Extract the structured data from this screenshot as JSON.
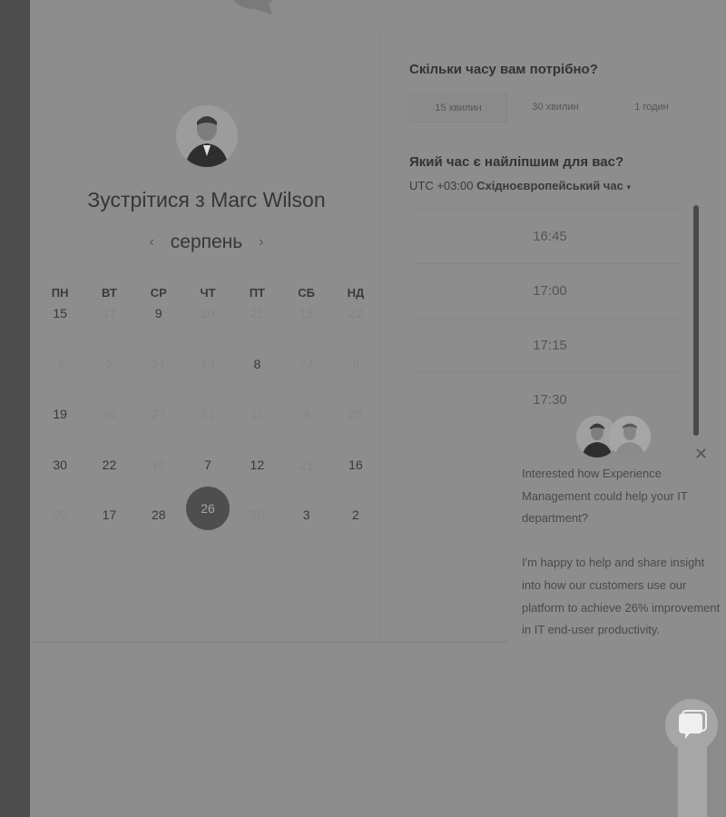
{
  "calendar_panel": {
    "title": "Зустрітися з Marc Wilson",
    "month": "серпень",
    "weekdays": [
      "ПН",
      "ВТ",
      "СР",
      "ЧТ",
      "ПТ",
      "СБ",
      "НД"
    ],
    "rows": [
      [
        {
          "d": "15",
          "dim": false
        },
        {
          "d": "17",
          "dim": true
        },
        {
          "d": "9",
          "dim": false
        },
        {
          "d": "20",
          "dim": true
        },
        {
          "d": "21",
          "dim": true
        },
        {
          "d": "13",
          "dim": true
        },
        {
          "d": "22",
          "dim": true
        }
      ],
      [
        {
          "d": "3",
          "dim": true
        },
        {
          "d": "2",
          "dim": true
        },
        {
          "d": "21",
          "dim": true
        },
        {
          "d": "19",
          "dim": true
        },
        {
          "d": "8",
          "dim": false
        },
        {
          "d": "24",
          "dim": true
        },
        {
          "d": "8",
          "dim": true
        }
      ],
      [
        {
          "d": "19",
          "dim": false
        },
        {
          "d": "24",
          "dim": true
        },
        {
          "d": "27",
          "dim": true
        },
        {
          "d": "21",
          "dim": true
        },
        {
          "d": "11",
          "dim": true
        },
        {
          "d": "9",
          "dim": true
        },
        {
          "d": "25",
          "dim": true
        }
      ],
      [
        {
          "d": "30",
          "dim": false
        },
        {
          "d": "22",
          "dim": false
        },
        {
          "d": "10",
          "dim": true
        },
        {
          "d": "7",
          "dim": false
        },
        {
          "d": "12",
          "dim": false
        },
        {
          "d": "21",
          "dim": true
        },
        {
          "d": "16",
          "dim": false
        }
      ],
      [
        {
          "d": "30",
          "dim": true
        },
        {
          "d": "17",
          "dim": false
        },
        {
          "d": "28",
          "dim": false
        },
        {
          "d": "26",
          "dim": false,
          "selected": true
        },
        {
          "d": "30",
          "dim": true
        },
        {
          "d": "3",
          "dim": false
        },
        {
          "d": "2",
          "dim": false
        }
      ]
    ]
  },
  "booking_panel": {
    "duration_question": "Скільки часу вам потрібно?",
    "durations": [
      "15 хвилин",
      "30 хвилин",
      "1 годин"
    ],
    "time_question": "Який час є найліпшим для вас?",
    "timezone_offset": "UTC +03:00",
    "timezone_name": "Східноєвропейський час",
    "times": [
      "16:45",
      "17:00",
      "17:15",
      "17:30"
    ]
  },
  "chat_popup": {
    "message_1": "Interested how Experience Management could help your IT department?",
    "message_2": "I'm happy to help and share insight into how our customers use our platform to achieve 26% improvement in IT end-user productivity."
  }
}
